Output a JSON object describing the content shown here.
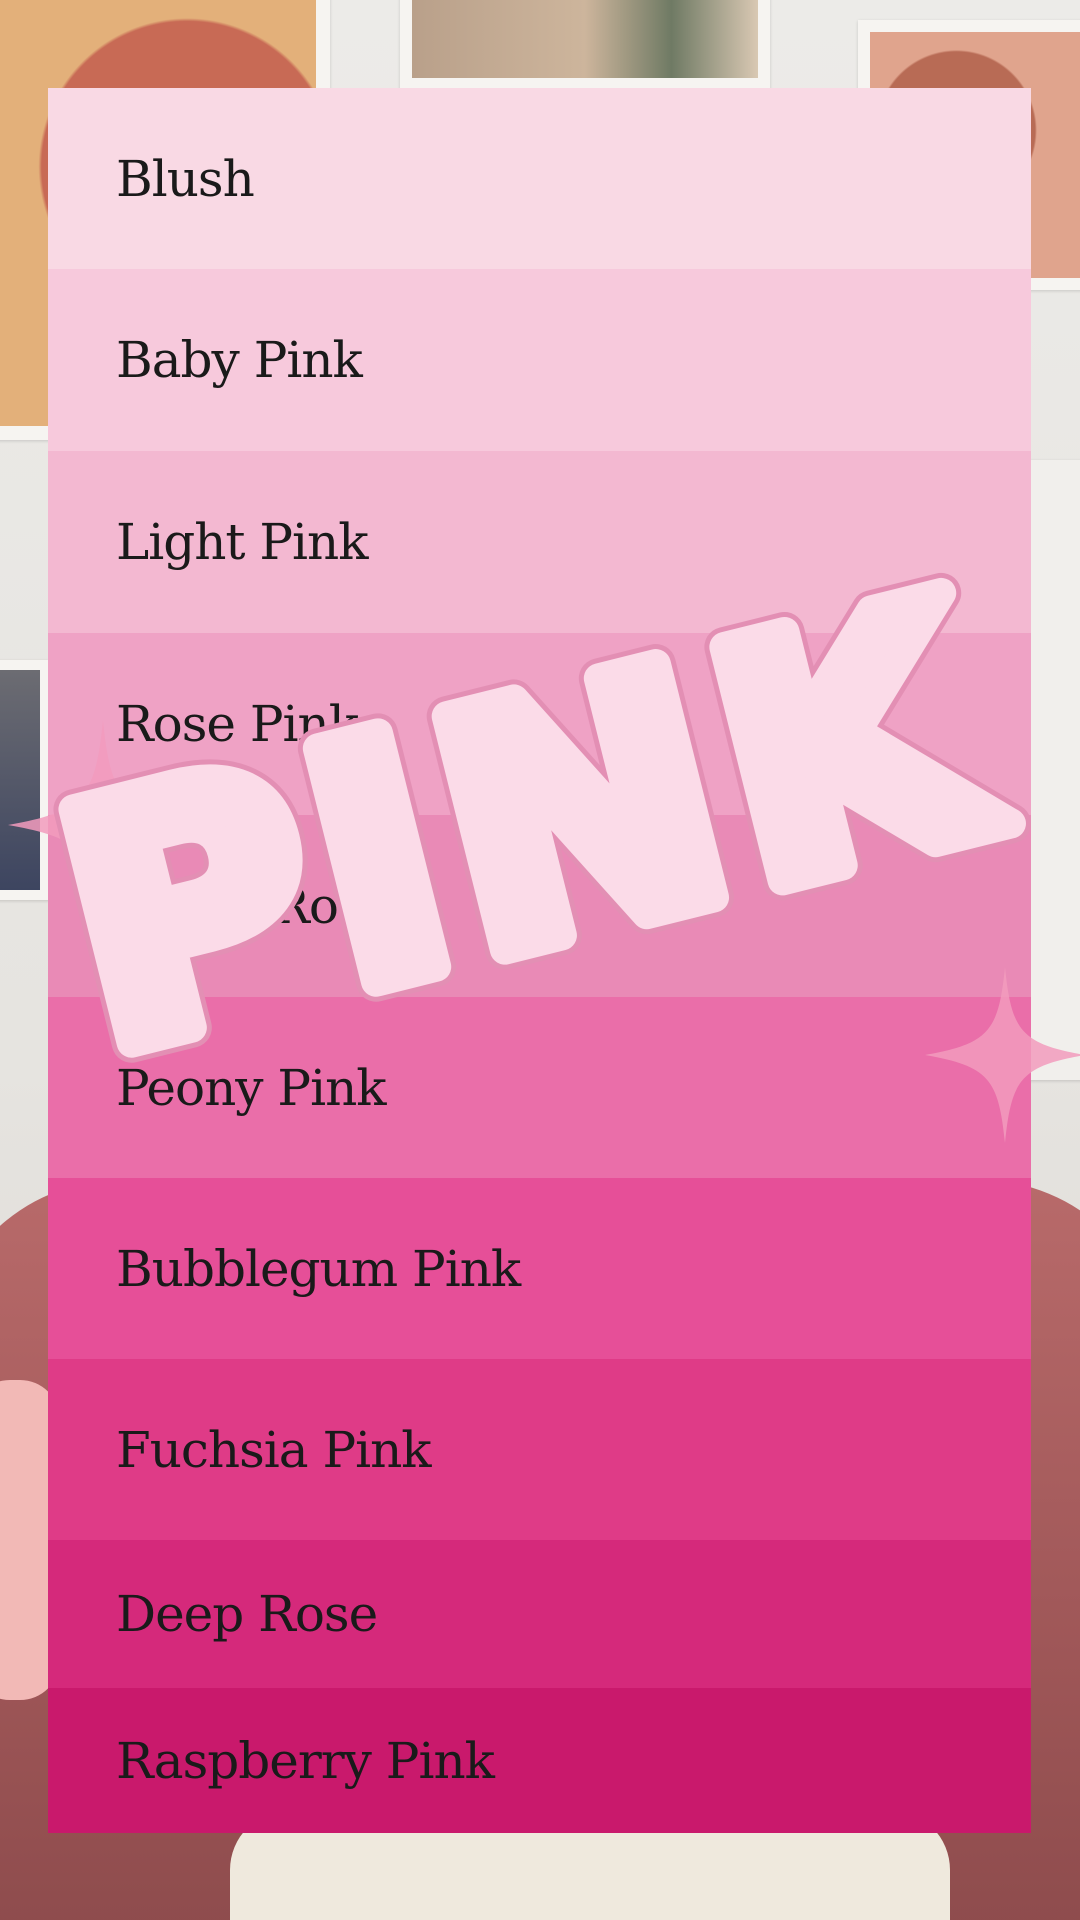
{
  "palette": {
    "swatches": [
      {
        "name": "Blush",
        "color": "#f9d9e4"
      },
      {
        "name": "Baby Pink",
        "color": "#f7c9dc"
      },
      {
        "name": "Light Pink",
        "color": "#f3b8d1"
      },
      {
        "name": "Rose Pink",
        "color": "#efa2c5"
      },
      {
        "name": "Dusty Rose",
        "color": "#e98ab6"
      },
      {
        "name": "Peony Pink",
        "color": "#ea6ea9"
      },
      {
        "name": "Bubblegum Pink",
        "color": "#e64f98"
      },
      {
        "name": "Fuchsia Pink",
        "color": "#df3b87"
      },
      {
        "name": "Deep Rose",
        "color": "#d5297b"
      },
      {
        "name": "Raspberry Pink",
        "color": "#c9196c"
      }
    ]
  },
  "overlay": {
    "word": "PINK",
    "fill_color": "#fbdbe8",
    "outline_color": "#e38fb4",
    "sparkle_color": "#f29bbd"
  }
}
